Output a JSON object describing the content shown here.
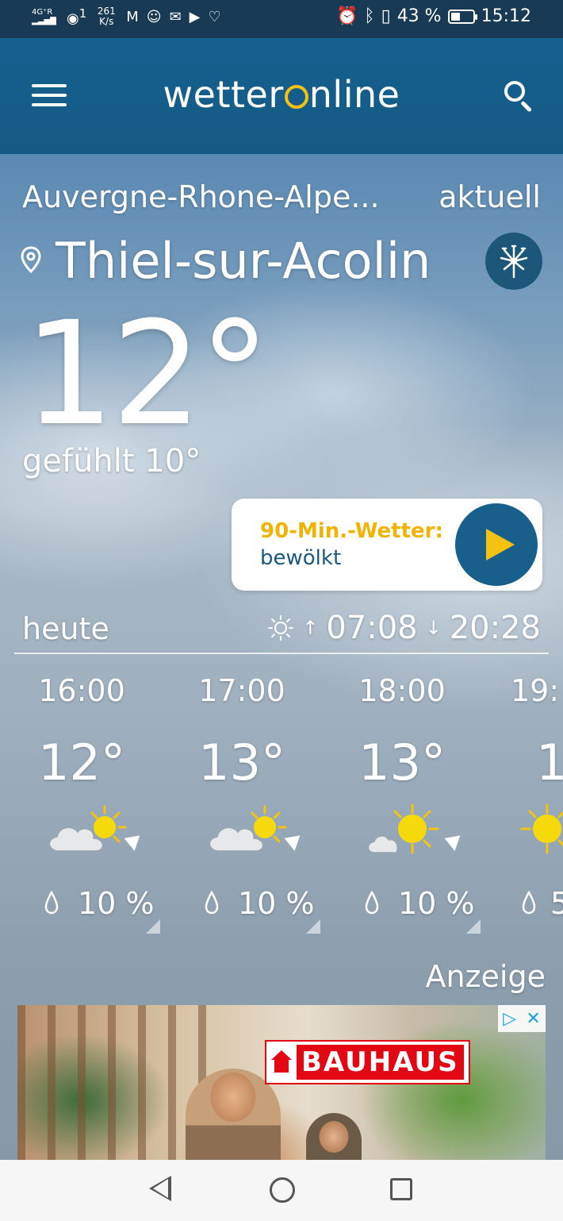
{
  "status_bar": {
    "network": "4G⁺R",
    "speed_value": "261",
    "speed_unit": "K/s",
    "wifi_index": "1",
    "app_m": "M",
    "battery_percent_text": "43 %",
    "battery_level": 0.43,
    "time": "15:12"
  },
  "header": {
    "logo_left": "wetter",
    "logo_right": "nline"
  },
  "location": {
    "region": "Auvergne-Rhone-Alpe...",
    "mode": "aktuell",
    "city": "Thiel-sur-Acolin"
  },
  "current": {
    "temperature": "12°",
    "felt": "gefühlt 10°"
  },
  "nowcast": {
    "label": "90-Min.-Wetter:",
    "condition": "bewölkt"
  },
  "today": {
    "label": "heute",
    "sunrise": "07:08",
    "sunset": "20:28",
    "sunrise_arrow": "↑",
    "sunset_arrow": "↓"
  },
  "hours": [
    {
      "time": "16:00",
      "temp": "12°",
      "precip": "10 %",
      "icon": "partly-cloudy"
    },
    {
      "time": "17:00",
      "temp": "13°",
      "precip": "10 %",
      "icon": "partly-cloudy"
    },
    {
      "time": "18:00",
      "temp": "13°",
      "precip": "10 %",
      "icon": "mostly-sunny"
    },
    {
      "time": "19:",
      "temp": "1",
      "precip": "5",
      "icon": "sunny"
    }
  ],
  "ad": {
    "label": "Anzeige",
    "brand": "BAUHAUS"
  },
  "colors": {
    "header_blue": "#15608f",
    "accent_yellow": "#f5c211",
    "status_bar": "#183a55"
  }
}
